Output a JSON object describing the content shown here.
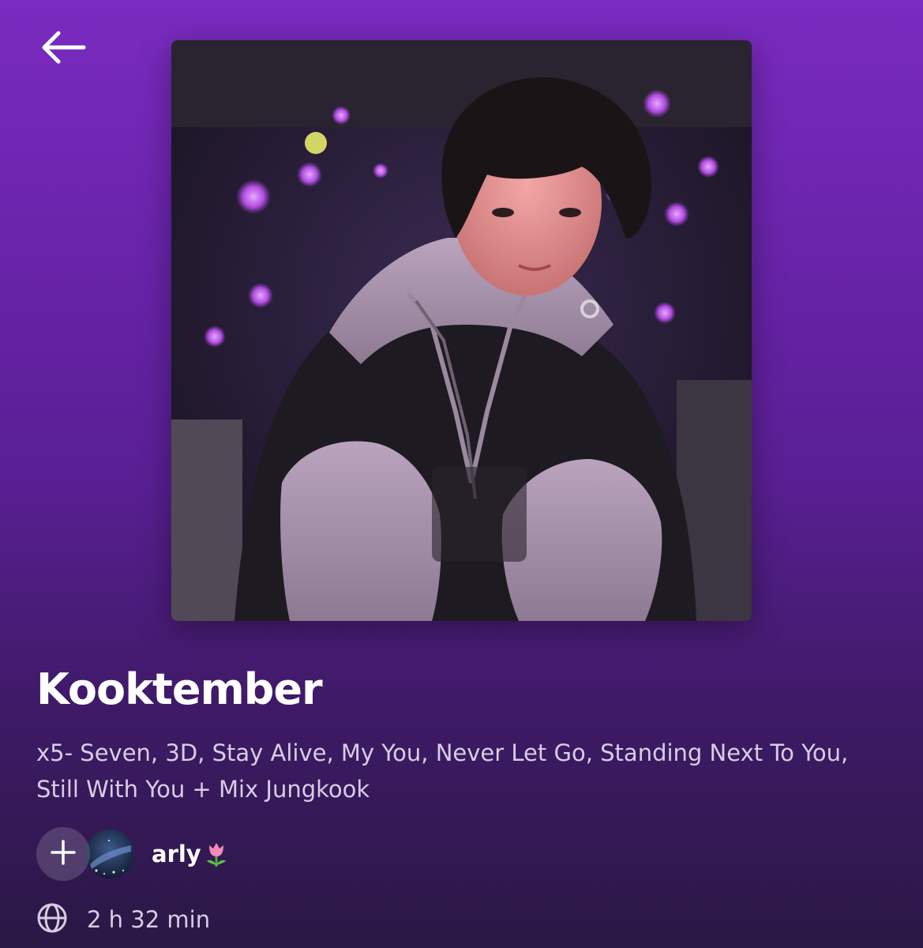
{
  "header": {
    "back_icon": "arrow-left-icon"
  },
  "cover": {
    "image": "playlist-cover-photo"
  },
  "playlist": {
    "title": "Kooktember",
    "description": "x5- Seven, 3D, Stay Alive, My You, Never Let Go, Standing Next To You, Still With You + Mix Jungkook",
    "owner": "arly",
    "owner_emoji_icon": "tulip-icon",
    "add_icon": "plus-icon",
    "visibility_icon": "globe-icon",
    "duration": "2 h 32 min"
  },
  "colors": {
    "gradient_top": "#7a2bc0",
    "gradient_bottom": "#2a1845",
    "description_text": "#d7cde4"
  }
}
